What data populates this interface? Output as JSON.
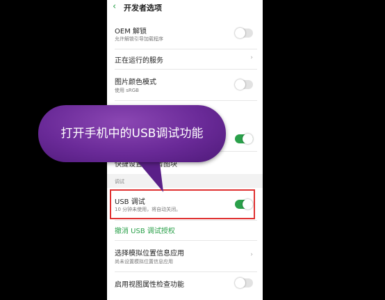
{
  "header": {
    "back_icon": "back-arrow-icon",
    "title": "开发者选项"
  },
  "rows": {
    "oem": {
      "label": "OEM 解锁",
      "sub": "允许解锁引导加载程序",
      "toggle": "off"
    },
    "running": {
      "label": "正在运行的服务"
    },
    "color_mode": {
      "label": "图片颜色模式",
      "sub": "使用 sRGB",
      "toggle": "off"
    },
    "tiles": {
      "label": "快捷设置开发者图块"
    }
  },
  "debug_section": {
    "label": "调试"
  },
  "usb_debug": {
    "label": "USB 调试",
    "sub": "10 分钟未使用，将自动关闭。",
    "toggle": "on"
  },
  "revoke": {
    "label": "撤消 USB 调试授权"
  },
  "mock_location": {
    "label": "选择模拟位置信息应用",
    "sub": "尚未设置模拟位置信息应用"
  },
  "view_attr": {
    "label": "启用视图属性检查功能",
    "toggle": "off"
  },
  "callout": {
    "text": "打开手机中的USB调试功能"
  },
  "colors": {
    "accent": "#2aa04a",
    "highlight": "#e03030",
    "bubble": "#6a2a98"
  }
}
